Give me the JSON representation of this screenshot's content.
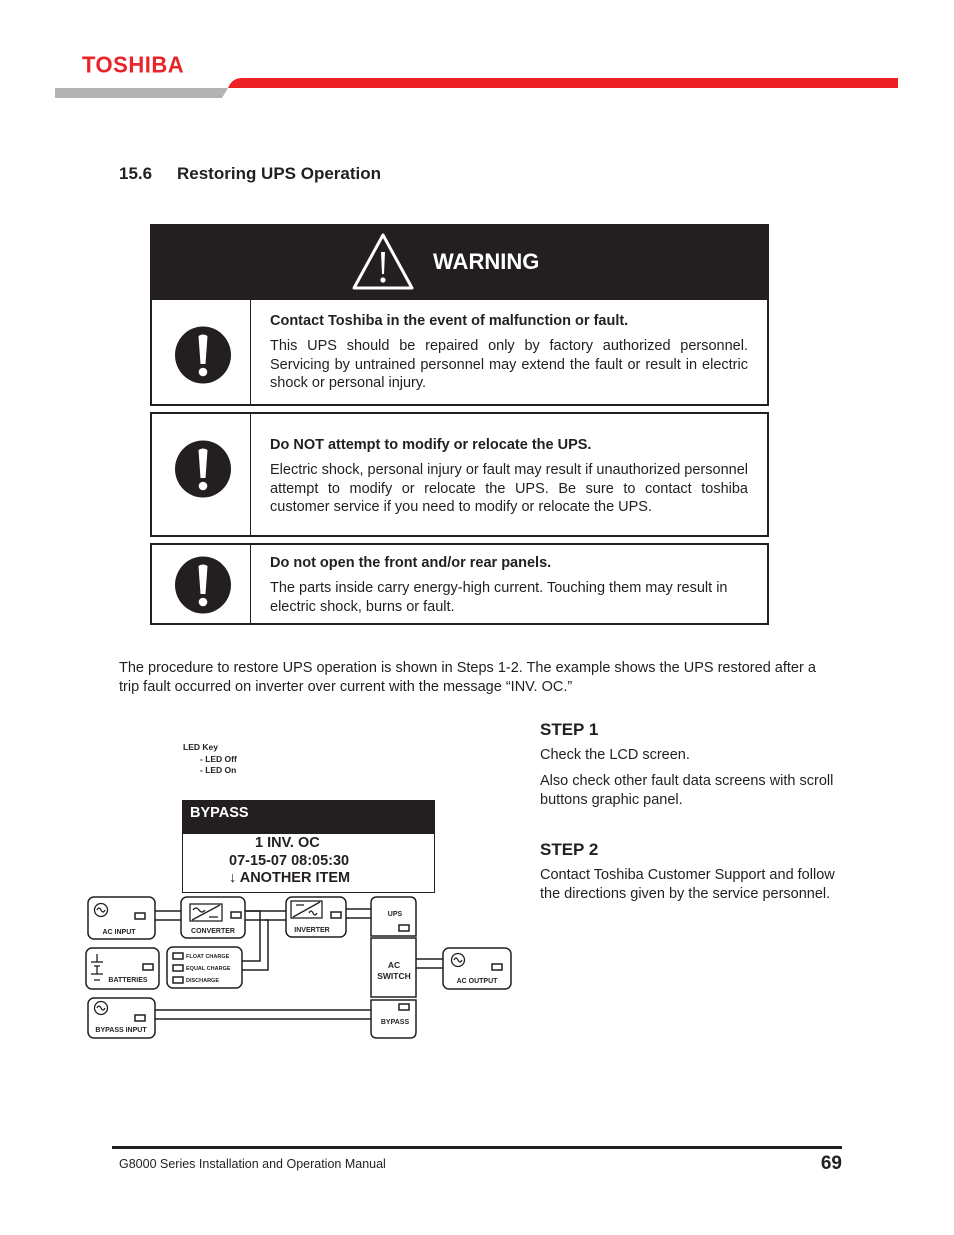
{
  "header": {
    "brand": "TOSHIBA",
    "colors": {
      "brand_red": "#e8252a",
      "band_gray": "#b3b3b3",
      "ink": "#231f20"
    }
  },
  "section": {
    "number": "15.6",
    "title": "Restoring UPS Operation"
  },
  "warning": {
    "title": "WARNING",
    "header_icon": "warning-triangle-icon",
    "items": [
      {
        "icon": "exclamation-circle-icon",
        "heading": "Contact Toshiba in the event of malfunction or fault.",
        "body": "This UPS should be repaired only by factory authorized personnel. Servicing by untrained personnel may extend the fault or result in electric shock or personal injury."
      },
      {
        "icon": "exclamation-circle-icon",
        "heading": "Do NOT attempt to modify or relocate the UPS.",
        "body": "Electric shock, personal injury or fault may result if unauthorized personnel attempt to modify or relocate the UPS. Be sure to contact toshiba customer service if you need to modify or relocate the UPS."
      },
      {
        "icon": "exclamation-circle-icon",
        "heading": "Do not open the front and/or rear panels.",
        "body": "The parts inside carry energy-high current. Touching them may result in electric shock, burns or fault."
      }
    ]
  },
  "intro": "The procedure to restore UPS operation is shown in Steps 1-2. The example shows the UPS restored after a trip fault occurred on inverter over current with the message “INV. OC.”",
  "diagram": {
    "led_key": {
      "title": "LED Key",
      "off": "- LED Off",
      "on": "- LED On"
    },
    "lcd": {
      "header": "BYPASS",
      "line1": "1 INV. OC",
      "line2": "07-15-07 08:05:30",
      "line3": "↓ ANOTHER ITEM"
    },
    "blocks": {
      "ac_input": "AC INPUT",
      "converter": "CONVERTER",
      "inverter": "INVERTER",
      "ups": "UPS",
      "ac_switch_1": "AC",
      "ac_switch_2": "SWITCH",
      "ac_output": "AC OUTPUT",
      "batteries": "BATTERIES",
      "float_charge": "FLOAT CHARGE",
      "equal_charge": "EQUAL CHARGE",
      "discharge": "DISCHARGE",
      "bypass_input": "BYPASS INPUT",
      "bypass": "BYPASS"
    }
  },
  "steps": [
    {
      "title": "STEP 1",
      "paragraphs": [
        "Check the LCD screen.",
        "Also check other fault data screens with scroll buttons graphic panel."
      ]
    },
    {
      "title": "STEP 2",
      "paragraphs": [
        "Contact Toshiba Customer Support and follow the directions given by the service personnel."
      ]
    }
  ],
  "footer": {
    "manual_title": "G8000 Series Installation and Operation Manual",
    "page_number": "69"
  }
}
